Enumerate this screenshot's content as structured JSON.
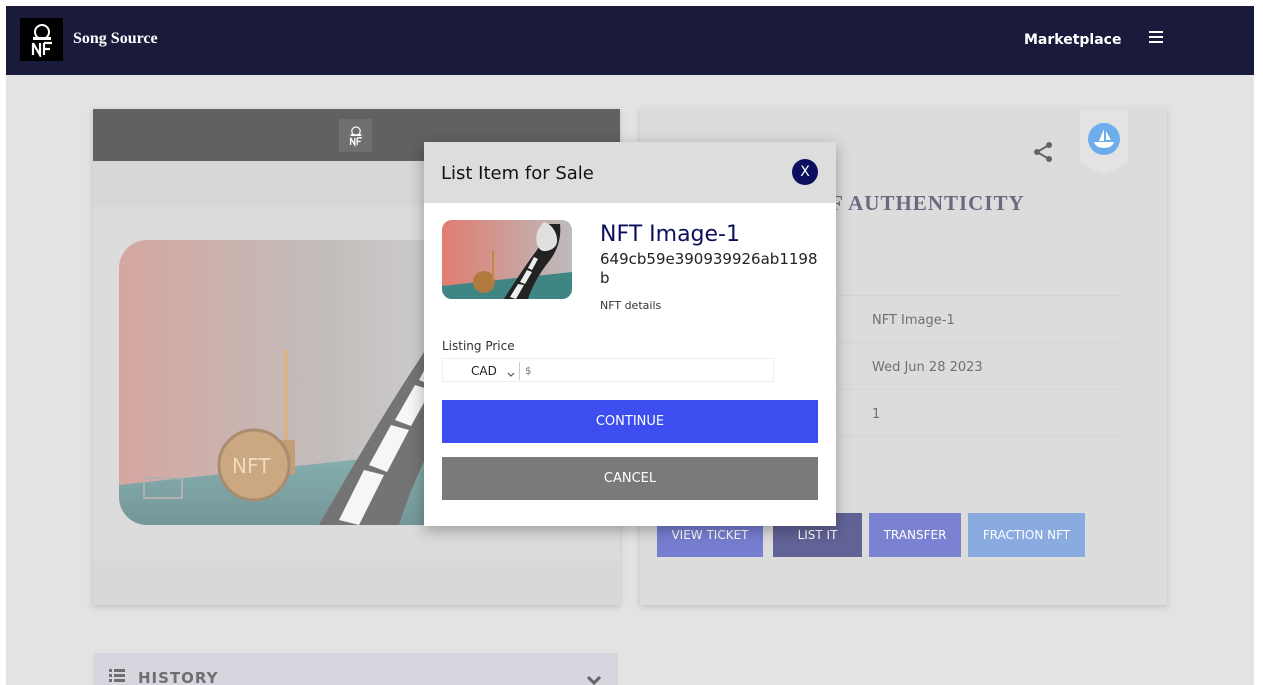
{
  "navbar": {
    "brand": "Song Source",
    "marketplace_label": "Marketplace",
    "menu_icon": "hamburger-icon",
    "logo_icon": "nft-logo-icon"
  },
  "certificate": {
    "title_partial": "F AUTHENTICITY",
    "rows": [
      {
        "value": "NFT Image-1"
      },
      {
        "value": "Wed Jun 28 2023"
      },
      {
        "value": "1"
      }
    ],
    "buttons": {
      "view_ticket": "VIEW TICKET",
      "list_it": "LIST IT",
      "transfer": "TRANSFER",
      "fraction": "FRACTION NFT"
    }
  },
  "history": {
    "label": "HISTORY"
  },
  "modal": {
    "title": "List Item for Sale",
    "close_label": "X",
    "item_name": "NFT Image-1",
    "item_id": "649cb59e390939926ab1198b",
    "item_details": "NFT details",
    "price_label": "Listing Price",
    "currency": "CAD",
    "price_placeholder": "$",
    "continue_label": "CONTINUE",
    "cancel_label": "CANCEL"
  },
  "colors": {
    "navbar_bg": "#1a1b3a",
    "primary_blue": "#3c4ef0",
    "dark_navy": "#0d0f5e",
    "cancel_gray": "#7a7a7a"
  }
}
